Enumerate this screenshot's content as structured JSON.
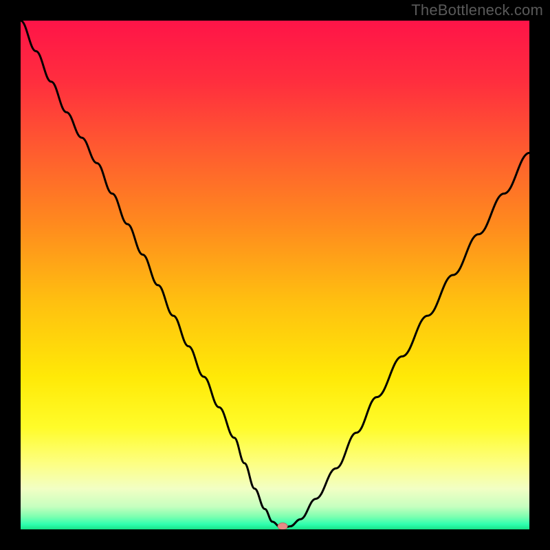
{
  "watermark": "TheBottleneck.com",
  "colors": {
    "page_bg": "#000000",
    "watermark": "#5a5a5a",
    "gradient_stops": [
      {
        "offset": 0.0,
        "color": "#ff1448"
      },
      {
        "offset": 0.12,
        "color": "#ff2e3e"
      },
      {
        "offset": 0.25,
        "color": "#ff5a30"
      },
      {
        "offset": 0.4,
        "color": "#ff8a1e"
      },
      {
        "offset": 0.55,
        "color": "#ffbf10"
      },
      {
        "offset": 0.7,
        "color": "#ffe907"
      },
      {
        "offset": 0.8,
        "color": "#fffc2a"
      },
      {
        "offset": 0.87,
        "color": "#fdff82"
      },
      {
        "offset": 0.92,
        "color": "#f2ffc4"
      },
      {
        "offset": 0.955,
        "color": "#c7ffbf"
      },
      {
        "offset": 0.975,
        "color": "#7dffb0"
      },
      {
        "offset": 0.99,
        "color": "#2fffaf"
      },
      {
        "offset": 1.0,
        "color": "#17e289"
      }
    ],
    "curve": "#000000",
    "marker_fill": "#e58a86",
    "marker_stroke": "#c06a66"
  },
  "chart_data": {
    "type": "line",
    "title": "",
    "xlabel": "",
    "ylabel": "",
    "xlim": [
      0,
      100
    ],
    "ylim": [
      0,
      100
    ],
    "x": [
      0,
      3,
      6,
      9,
      12,
      15,
      18,
      21,
      24,
      27,
      30,
      33,
      36,
      39,
      42,
      44,
      46,
      48,
      49.5,
      51,
      52,
      53,
      55,
      58,
      62,
      66,
      70,
      75,
      80,
      85,
      90,
      95,
      100
    ],
    "values": [
      100,
      94,
      88,
      82,
      77,
      72,
      66,
      60,
      54,
      48,
      42,
      36,
      30,
      24,
      18,
      13,
      8,
      4,
      1.5,
      0.5,
      0.4,
      0.6,
      2,
      6,
      12,
      19,
      26,
      34,
      42,
      50,
      58,
      66,
      74
    ],
    "marker": {
      "x": 51.5,
      "y": 0.6
    },
    "notes": "V-shaped bottleneck curve; minimum ≈ x 51–52, y ≈ 0.5; left branch steeper than right; values estimated from pixels (no axes/ticks visible)."
  }
}
